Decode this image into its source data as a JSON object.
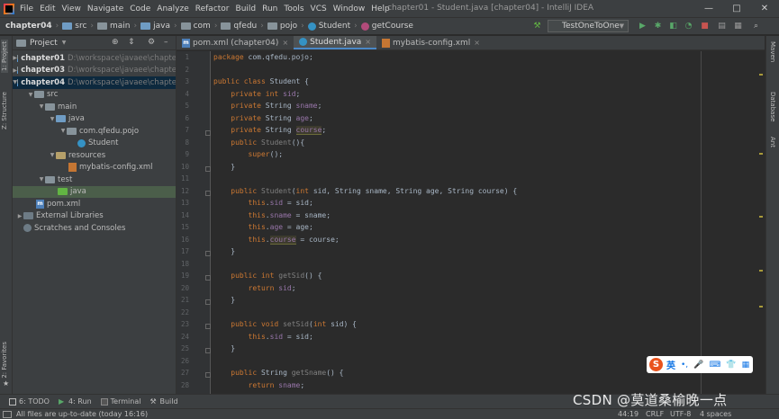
{
  "menubar": {
    "items": [
      "File",
      "Edit",
      "View",
      "Navigate",
      "Code",
      "Analyze",
      "Refactor",
      "Build",
      "Run",
      "Tools",
      "VCS",
      "Window",
      "Help"
    ],
    "window_title": "chapter01 - Student.java [chapter04] - IntelliJ IDEA",
    "controls": [
      "—",
      "□",
      "✕"
    ]
  },
  "navbar": {
    "crumbs": [
      "chapter04",
      "src",
      "main",
      "java",
      "com",
      "qfedu",
      "pojo",
      "Student",
      "getCourse"
    ],
    "run_config": "TestOneToOne"
  },
  "left_strip": {
    "project_tab": "1: Project",
    "structure_tab": "Z: Structure",
    "favorites_tab": "2: Favorites"
  },
  "project_panel": {
    "title": "Project",
    "tree": [
      {
        "label": "chapter01",
        "path": "D:\\workspace\\javaee\\chapte",
        "indent": 0
      },
      {
        "label": "chapter03",
        "path": "D:\\workspace\\javaee\\chapte",
        "indent": 0
      },
      {
        "label": "chapter04",
        "path": "D:\\workspace\\javaee\\chapte",
        "indent": 0
      },
      {
        "label": "src",
        "indent": 1
      },
      {
        "label": "main",
        "indent": 2
      },
      {
        "label": "java",
        "indent": 3
      },
      {
        "label": "com.qfedu.pojo",
        "indent": 4
      },
      {
        "label": "Student",
        "indent": 5
      },
      {
        "label": "resources",
        "indent": 3
      },
      {
        "label": "mybatis-config.xml",
        "indent": 4
      },
      {
        "label": "test",
        "indent": 2
      },
      {
        "label": "java",
        "indent": 3
      },
      {
        "label": "pom.xml",
        "indent": 1
      },
      {
        "label": "External Libraries",
        "indent": 0
      },
      {
        "label": "Scratches and Consoles",
        "indent": 0
      }
    ]
  },
  "tabs": [
    {
      "label": "pom.xml (chapter04)",
      "active": false
    },
    {
      "label": "Student.java",
      "active": true
    },
    {
      "label": "mybatis-config.xml",
      "active": false
    }
  ],
  "editor": {
    "line_numbers": [
      "1",
      "2",
      "3",
      "4",
      "5",
      "6",
      "7",
      "8",
      "9",
      "10",
      "11",
      "12",
      "13",
      "14",
      "15",
      "16",
      "17",
      "18",
      "19",
      "20",
      "21",
      "22",
      "23",
      "24",
      "25",
      "26",
      "27",
      "28"
    ]
  },
  "right_strip": {
    "tabs": [
      "Maven",
      "Database",
      "Ant"
    ]
  },
  "bottom_bar": {
    "tabs": [
      "6: TODO",
      "4: Run",
      "Terminal",
      "Build"
    ]
  },
  "status_bar": {
    "message": "All files are up-to-date (today 16:16)",
    "position": "44:19",
    "line_sep": "CRLF",
    "encoding": "UTF-8",
    "indent": "4 spaces"
  },
  "ime_toolbar": {
    "logo": "S",
    "mode": "英"
  },
  "watermark": "CSDN @莫道桑榆晚一点",
  "colors": {
    "keyword": "#cc7832",
    "field": "#9876aa",
    "method": "#ffc66d",
    "text": "#a9b7c6",
    "background": "#2b2b2b"
  }
}
